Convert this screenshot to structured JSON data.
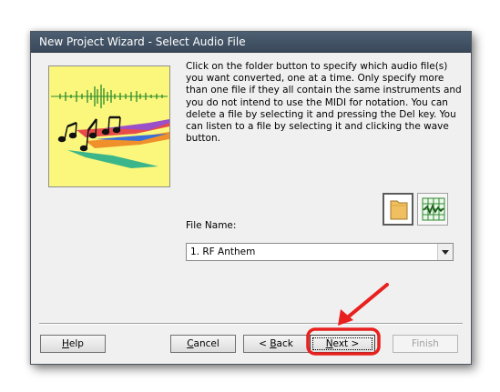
{
  "window": {
    "title": "New Project Wizard - Select Audio File"
  },
  "description": "Click on the folder button to specify which audio file(s) you want converted, one at a time. Only specify more than one file if they all contain the same instruments and you do not intend to use the MIDI for notation. You can delete a file by selecting it and pressing the Del key. You can listen to a file by selecting it and clicking the wave button.",
  "file_name": {
    "label": "File Name:",
    "selected_value": "1. RF Anthem"
  },
  "toolbar": {
    "folder_icon": "folder-icon",
    "wave_icon": "wave-grid-icon"
  },
  "buttons": {
    "help": {
      "mnemonic": "H",
      "rest": "elp"
    },
    "cancel": {
      "mnemonic": "C",
      "rest": "ancel"
    },
    "back": {
      "prefix": "< ",
      "mnemonic": "B",
      "rest": "ack"
    },
    "next": {
      "mnemonic": "N",
      "rest": "ext >"
    },
    "finish": {
      "label": "Finish"
    }
  },
  "annotation": {
    "color": "#e8201e",
    "target": "next-button"
  },
  "colors": {
    "title_bar": "#3f5063",
    "picture_background": "#fbf77d",
    "dialog_background": "#f0f0f0"
  }
}
